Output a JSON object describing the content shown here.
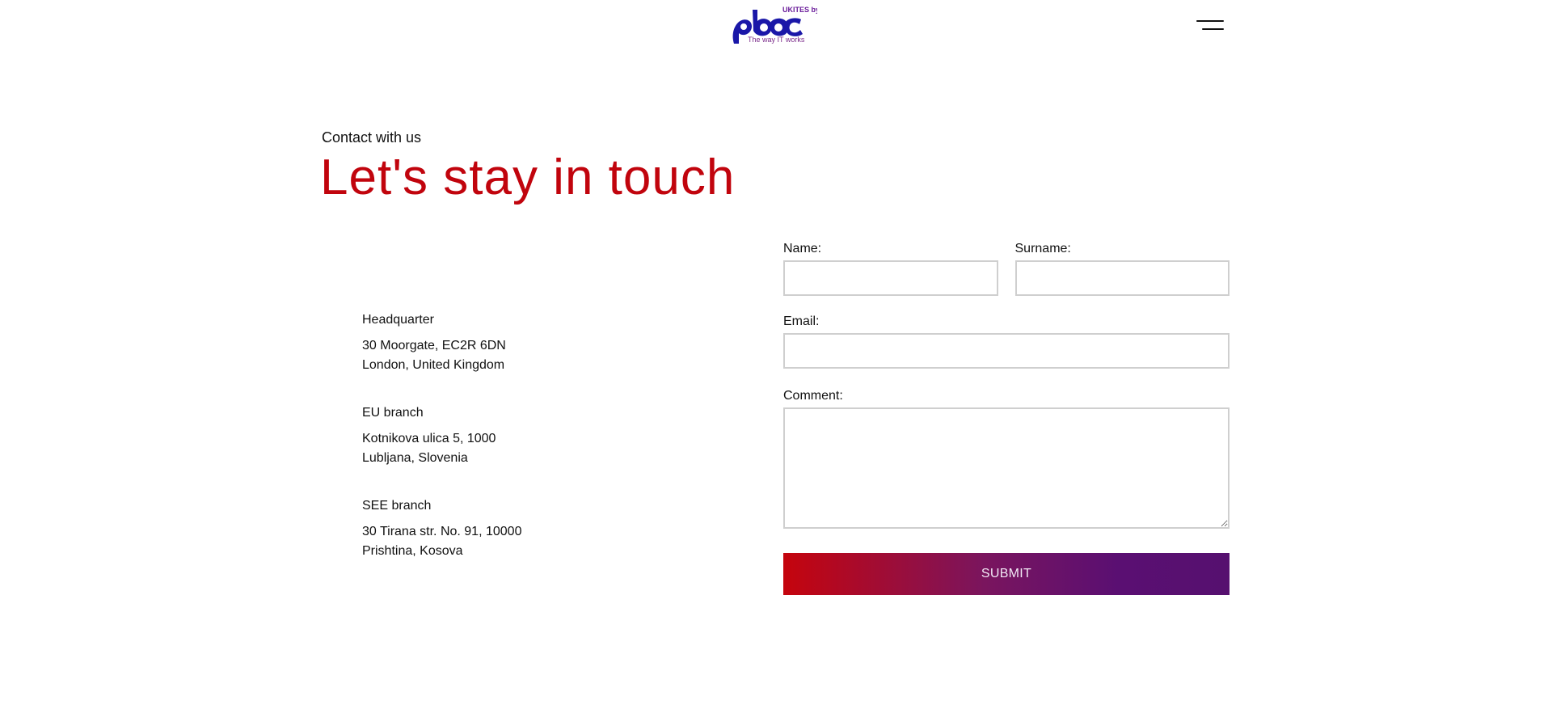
{
  "header": {
    "logo": {
      "top_text": "UKITES by",
      "tagline": "The way IT works",
      "brand_color": "#1a17a8",
      "accent_color": "#c1040d"
    },
    "menu_icon": "hamburger-menu-icon"
  },
  "hero": {
    "eyebrow": "Contact with us",
    "headline": "Let's stay in touch",
    "headline_color": "#c1040d"
  },
  "offices": [
    {
      "name": "Headquarter",
      "line1": "30 Moorgate, EC2R 6DN",
      "line2": "London, United Kingdom"
    },
    {
      "name": "EU branch",
      "line1": "Kotnikova ulica 5, 1000",
      "line2": "Lubljana, Slovenia"
    },
    {
      "name": "SEE branch",
      "line1": "30 Tirana str. No. 91, 10000",
      "line2": "Prishtina, Kosova"
    }
  ],
  "form": {
    "name_label": "Name:",
    "name_value": "",
    "surname_label": "Surname:",
    "surname_value": "",
    "email_label": "Email:",
    "email_value": "",
    "comment_label": "Comment:",
    "comment_value": "",
    "submit_label": "SUBMIT",
    "submit_gradient": [
      "#c5040d",
      "#56106f"
    ]
  }
}
